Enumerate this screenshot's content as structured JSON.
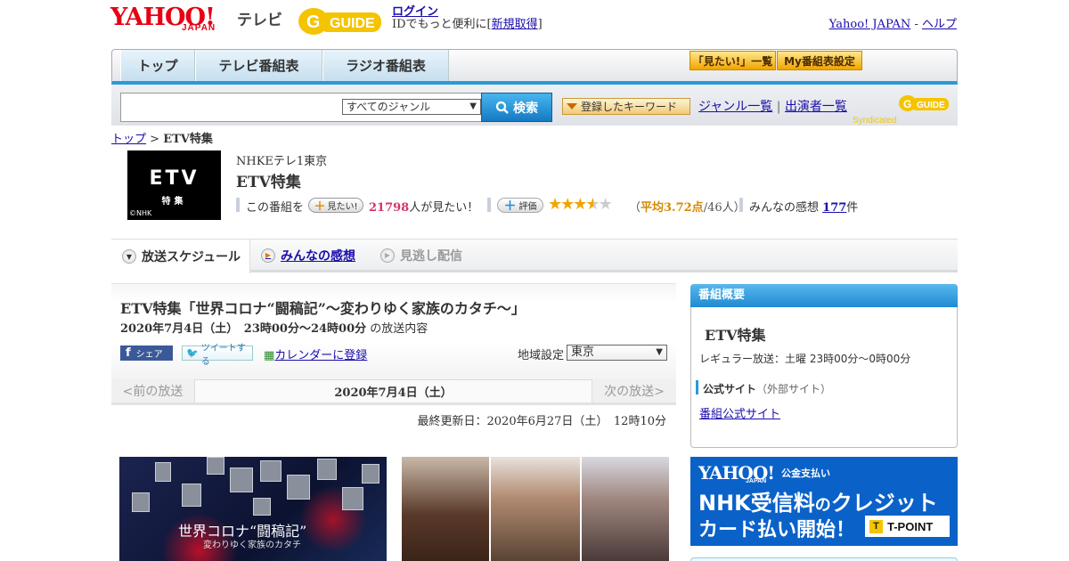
{
  "header": {
    "logo_yahoo": "YAHOO!",
    "logo_japan": "JAPAN",
    "logo_tv": "テレビ",
    "gguide_letter": "G",
    "gguide_word": "GUIDE",
    "login": "ログイン",
    "msg_prefix": "IDでもっと便利に[",
    "register": "新規取得",
    "msg_suffix": "]",
    "yahoo_japan_link": "Yahoo! JAPAN",
    "separator": "-",
    "help_link": "ヘルプ"
  },
  "nav": {
    "tabs": [
      "トップ",
      "テレビ番組表",
      "ラジオ番組表"
    ],
    "want_list": "「見たい!」一覧",
    "my_schedule": "My番組表設定"
  },
  "search": {
    "genre_selected": "すべてのジャンル",
    "button": "検索",
    "keyword_button": "登録したキーワード",
    "genre_list": "ジャンル一覧",
    "divider": "|",
    "cast_list": "出演者一覧",
    "syndicated": "Syndicated"
  },
  "breadcrumb": {
    "top": "トップ",
    "sep": ">",
    "current": "ETV特集"
  },
  "program": {
    "thumb_line1": "ETV",
    "thumb_line2": "特集",
    "thumb_credit": "©NHK",
    "channel": "NHKEテレ1東京",
    "title": "ETV特集",
    "want_prefix": "この番組を",
    "want_button": "見たい!",
    "want_count": "21798",
    "want_suffix": "人が見たい！",
    "rate_button": "評価",
    "rating_value": 3.72,
    "avg_prefix": "（",
    "avg_text": "平均3.72点",
    "avg_count": "/46人）",
    "reviews_prefix": "みんなの感想",
    "reviews_count": "177",
    "reviews_suffix": "件",
    "colors": {
      "accent": "#2a9ad8",
      "want_count": "#d6336c",
      "stars": "#f0a500"
    }
  },
  "tabs": {
    "schedule": "放送スケジュール",
    "reviews": "みんなの感想",
    "stream": "見逃し配信"
  },
  "schedule": {
    "title": "ETV特集「世界コロナ“闘稿記”～変わりゆく家族のカタチ～」",
    "date_time": "2020年7月4日（土）　23時00分～24時00分",
    "content_suffix": "の放送内容",
    "share_fb": "シェア",
    "share_tw": "ツイートする",
    "calendar": "カレンダーに登録",
    "region_label": "地域設定",
    "region_value": "東京",
    "prev": "<前の放送",
    "current_date": "2020年7月4日（土）",
    "next": "次の放送>",
    "last_updated": "最終更新日：2020年6月27日（土）　12時10分"
  },
  "images": {
    "caption": "世界コロナ“闘稿記”",
    "subcaption": "変わりゆく家族のカタチ"
  },
  "overview": {
    "header": "番組概要",
    "title": "ETV特集",
    "regular": "レギュラー放送：土曜 23時00分～0時00分",
    "site_label": "公式サイト",
    "site_ext": "（外部サイト）",
    "site_link": "番組公式サイト"
  },
  "banner": {
    "yahoo": "YAHOO!",
    "japan": "JAPAN",
    "public_pay": "公金支払い",
    "line1_a": "NHK受信料",
    "line1_b": "の",
    "line1_c": "クレジット",
    "line2": "カード払い開始！",
    "tpoint": "T-POINT",
    "tpoint_mark": "T"
  }
}
